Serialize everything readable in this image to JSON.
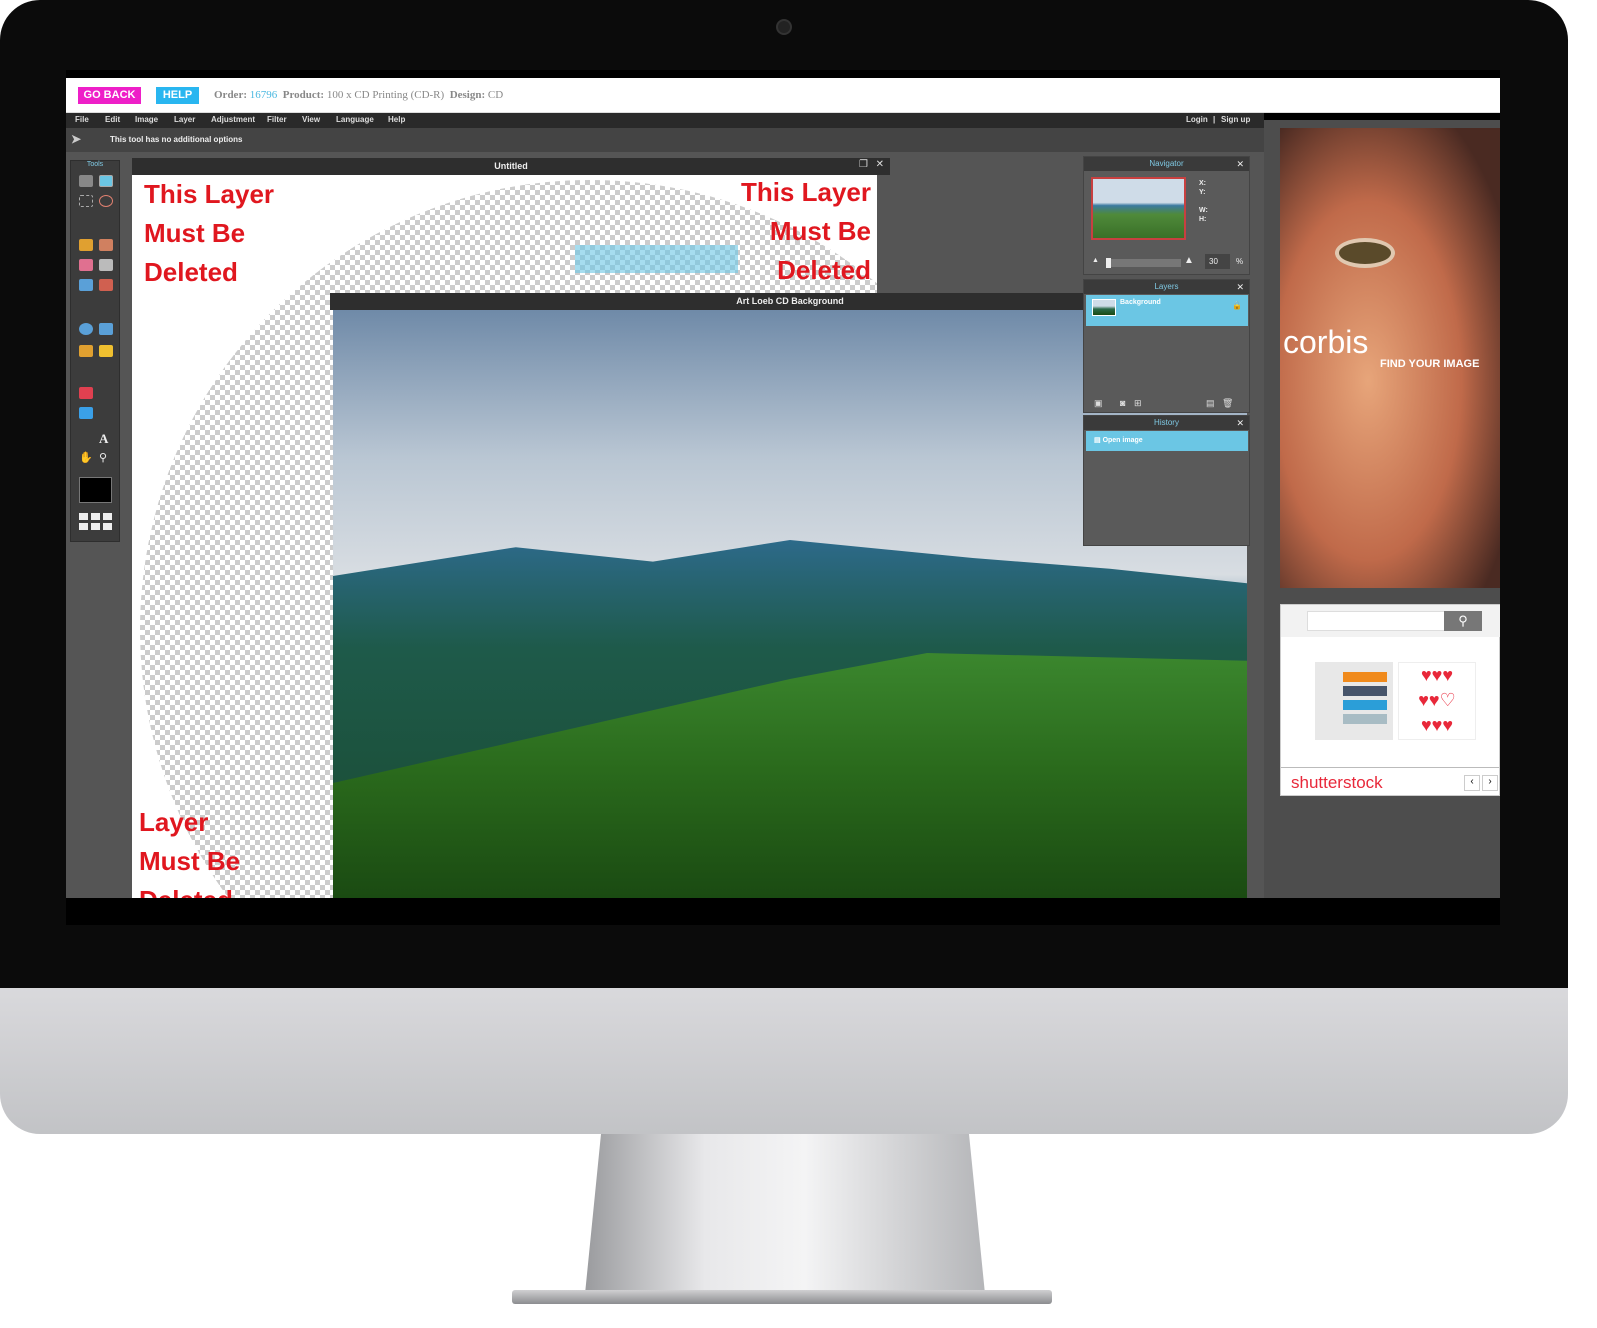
{
  "topbar": {
    "go_back": "GO BACK",
    "help": "HELP",
    "order_label": "Order:",
    "order_value": "16796",
    "product_label": "Product:",
    "product_value": "100 x CD Printing (CD-R)",
    "design_label": "Design:",
    "design_value": "CD",
    "colors": {
      "go_back": "#ee1fc8",
      "help": "#29b6f0",
      "order_value": "#4ab8e0"
    }
  },
  "menu": {
    "items": [
      "File",
      "Edit",
      "Image",
      "Layer",
      "Adjustment",
      "Filter",
      "View",
      "Language",
      "Help"
    ],
    "login": "Login",
    "separator": "|",
    "signup": "Sign up"
  },
  "options": {
    "text": "This tool has no additional options"
  },
  "tools": {
    "title": "Tools"
  },
  "untitled": {
    "title": "Untitled",
    "text_left": [
      "This Layer",
      "Must Be",
      "Deleted"
    ],
    "text_right": [
      "This Layer",
      "Must Be",
      "Deleted"
    ],
    "text_bottom": [
      "Layer",
      "Must Be",
      "Deleted"
    ]
  },
  "photo": {
    "title": "Art Loeb CD Background"
  },
  "navigator": {
    "title": "Navigator",
    "x": "X:",
    "y": "Y:",
    "w": "W:",
    "h": "H:",
    "zoom": "30",
    "unit": "%"
  },
  "layers": {
    "title": "Layers",
    "items": [
      {
        "name": "Background",
        "locked": true
      }
    ]
  },
  "history": {
    "title": "History",
    "items": [
      "Open image"
    ]
  },
  "ads": {
    "corbis": "corbis",
    "corbis_tagline": "FIND YOUR IMAGE",
    "shutterstock": "shutterstock"
  },
  "accent": "#6bc6e4"
}
